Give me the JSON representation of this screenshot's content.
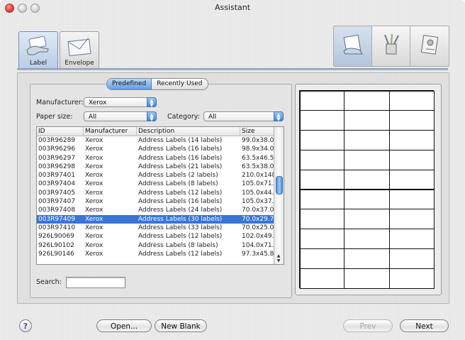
{
  "window": {
    "title": "Assistant"
  },
  "tabs": [
    {
      "label": "Label",
      "icon": "label-hand-icon",
      "active": true
    },
    {
      "label": "Envelope",
      "icon": "envelope-icon",
      "active": false
    }
  ],
  "view_buttons": [
    {
      "icon": "labels-view-icon",
      "active": true
    },
    {
      "icon": "pencil-cup-icon",
      "active": false
    },
    {
      "icon": "address-book-icon",
      "active": false
    }
  ],
  "segmented": {
    "predefined": "Predefined",
    "recent": "Recently Used"
  },
  "filters": {
    "manufacturer_label": "Manufacturer:",
    "manufacturer_value": "Xerox",
    "paper_label": "Paper size:",
    "paper_value": "All",
    "category_label": "Category:",
    "category_value": "All"
  },
  "table": {
    "headers": [
      "ID",
      "Manufacturer",
      "Description",
      "Size"
    ],
    "rows": [
      [
        "003R96289",
        "Xerox",
        "Address Labels (14 labels)",
        "99.0x38.0"
      ],
      [
        "003R96296",
        "Xerox",
        "Address Labels (16 labels)",
        "98.9x34.0"
      ],
      [
        "003R96297",
        "Xerox",
        "Address Labels (16 labels)",
        "63.5x46.5"
      ],
      [
        "003R96298",
        "Xerox",
        "Address Labels (21 labels)",
        "63.5x38.0"
      ],
      [
        "003R97401",
        "Xerox",
        "Address Labels (2 labels)",
        "210.0x148"
      ],
      [
        "003R97404",
        "Xerox",
        "Address Labels (8 labels)",
        "105.0x71."
      ],
      [
        "003R97405",
        "Xerox",
        "Address Labels (12 labels)",
        "105.0x44."
      ],
      [
        "003R97407",
        "Xerox",
        "Address Labels (16 labels)",
        "105.0x37."
      ],
      [
        "003R97408",
        "Xerox",
        "Address Labels (24 labels)",
        "70.0x37.0"
      ],
      [
        "003R97409",
        "Xerox",
        "Address Labels (30 labels)",
        "70.0x29.7"
      ],
      [
        "003R97410",
        "Xerox",
        "Address Labels (33 labels)",
        "70.0x25.0"
      ],
      [
        "926L90069",
        "Xerox",
        "Address Labels (12 labels)",
        "102.0x49."
      ],
      [
        "926L90102",
        "Xerox",
        "Address Labels (8 labels)",
        "104.0x71."
      ],
      [
        "926L90146",
        "Xerox",
        "Address Labels (12 labels)",
        "97.3x45.8"
      ]
    ],
    "selected_row": 9
  },
  "search": {
    "label": "Search:",
    "value": ""
  },
  "preview": {
    "columns": 3,
    "rows": 10
  },
  "buttons": {
    "help": "?",
    "open": "Open...",
    "new_blank": "New Blank",
    "prev": "Prev",
    "next": "Next"
  }
}
